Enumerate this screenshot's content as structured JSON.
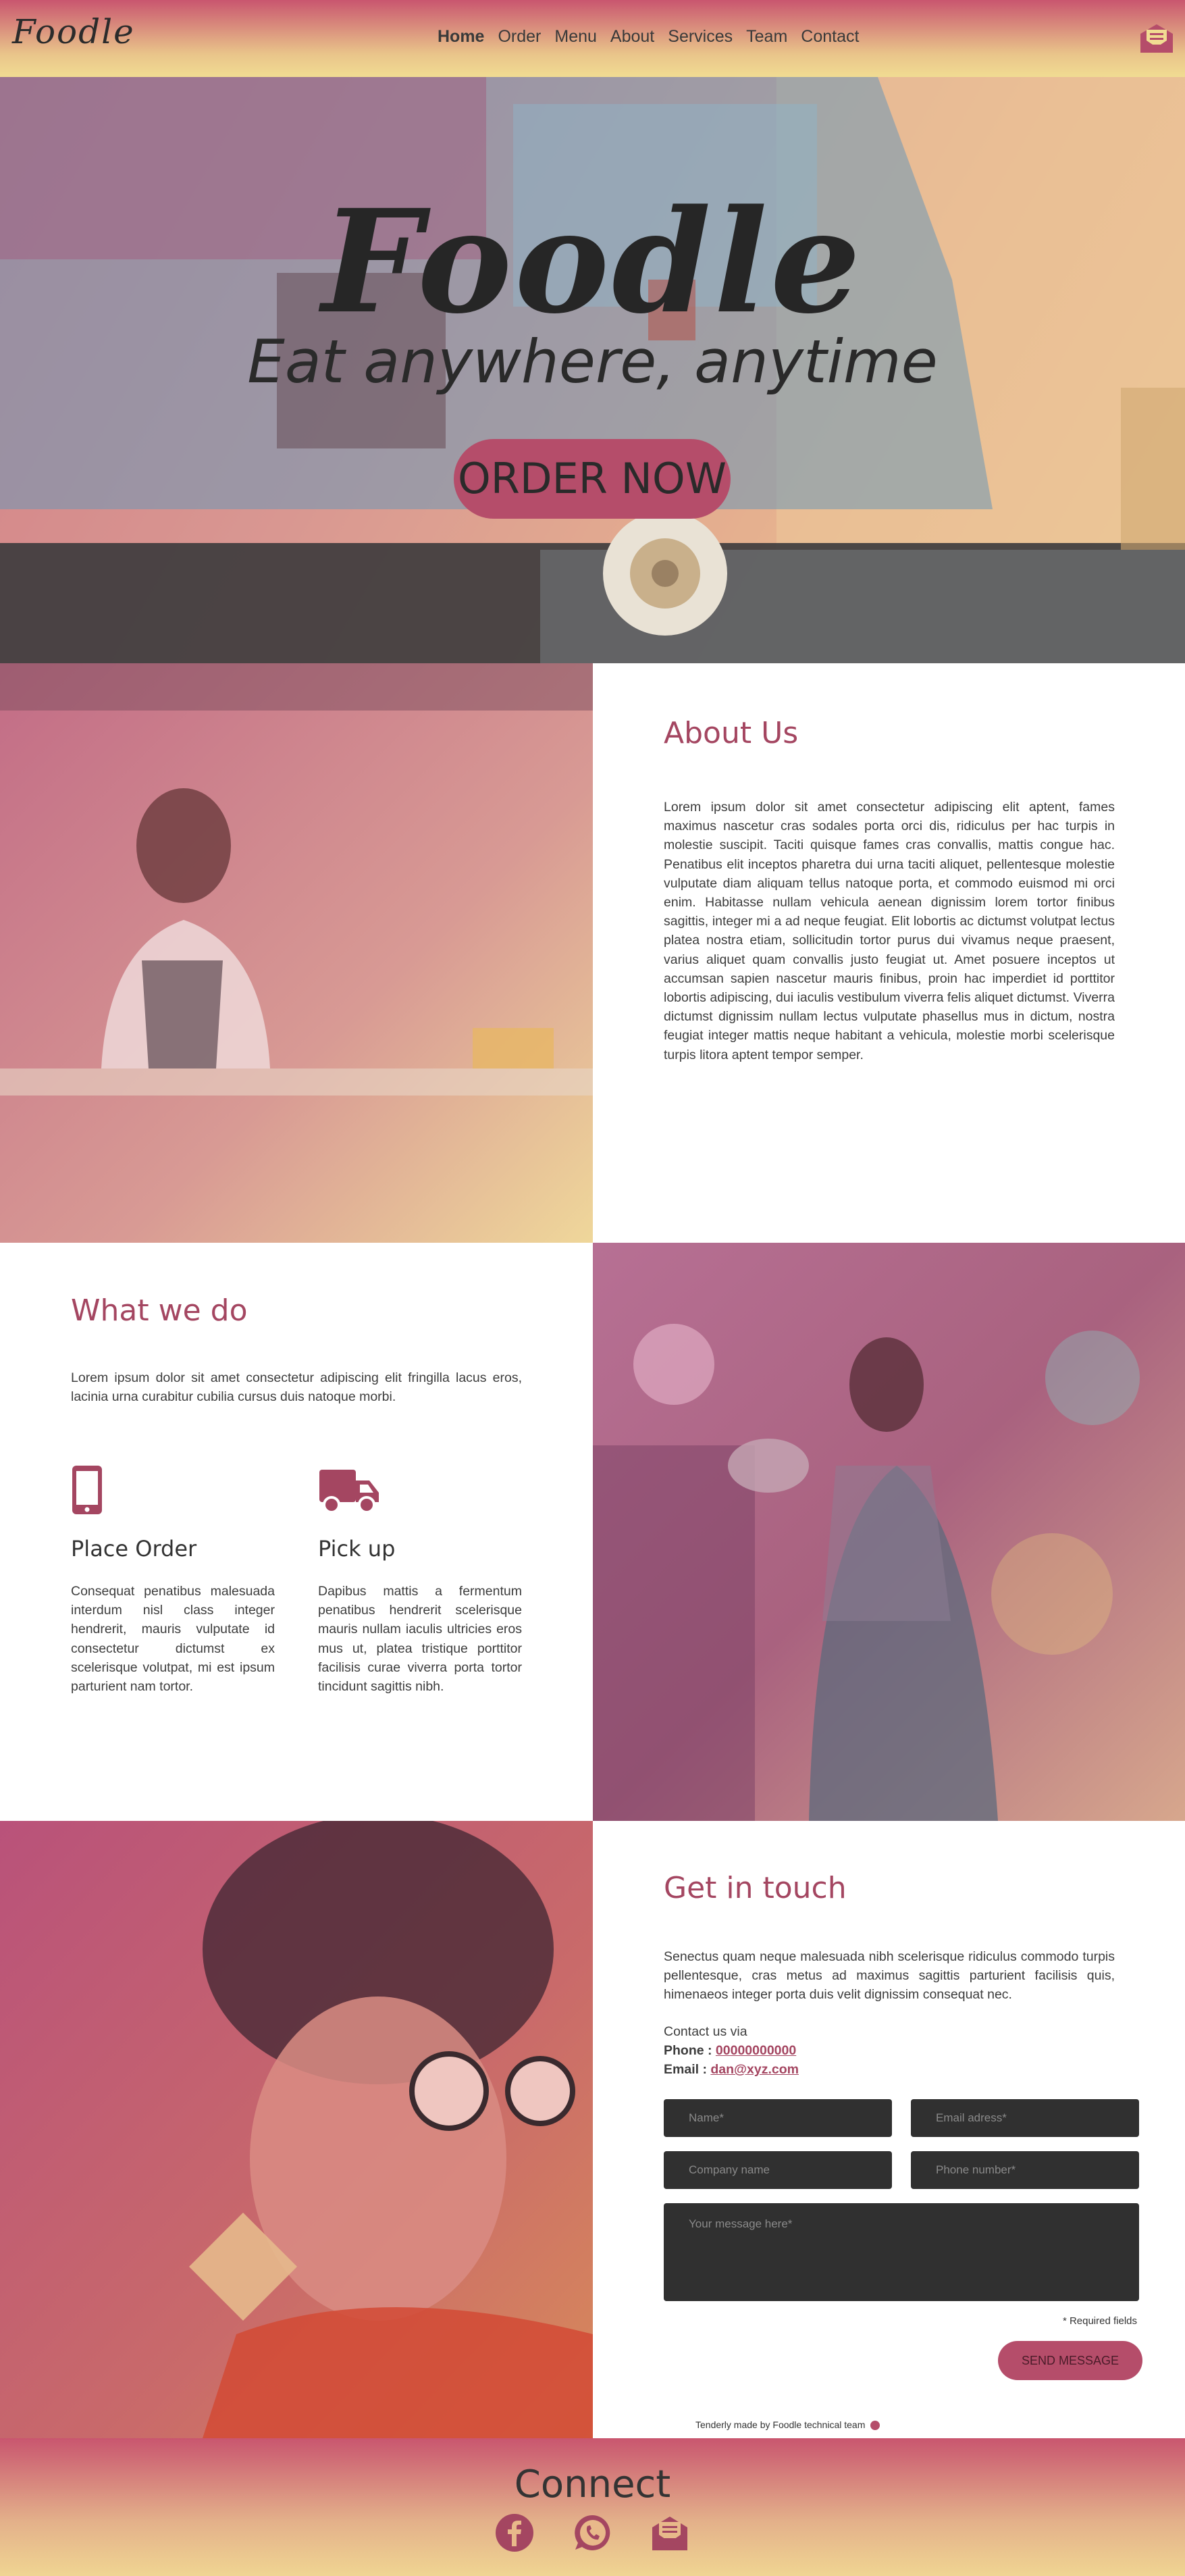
{
  "nav": {
    "logo": "Foodle",
    "items": [
      "Home",
      "Order",
      "Menu",
      "About",
      "Services",
      "Team",
      "Contact"
    ],
    "icon": "mail-icon"
  },
  "hero": {
    "title": "Foodle",
    "subtitle": "Eat anywhere, anytime",
    "cta": "ORDER NOW"
  },
  "about": {
    "title": "About Us",
    "body": "Lorem ipsum dolor sit amet consectetur adipiscing elit aptent, fames maximus nascetur cras sodales porta orci dis, ridiculus per hac turpis in molestie suscipit. Taciti quisque fames cras convallis, mattis congue hac. Penatibus elit inceptos pharetra dui urna taciti aliquet, pellentesque molestie vulputate diam aliquam tellus natoque porta, et commodo euismod mi orci enim. Habitasse nullam vehicula aenean dignissim lorem tortor finibus sagittis, integer mi a ad neque feugiat. Elit lobortis ac dictumst volutpat lectus platea nostra etiam, sollicitudin tortor purus dui vivamus neque praesent, varius aliquet quam convallis justo feugiat ut. Amet posuere inceptos ut accumsan sapien nascetur mauris finibus, proin hac imperdiet id porttitor lobortis adipiscing, dui iaculis vestibulum viverra felis aliquet dictumst. Viverra dictumst dignissim nullam lectus vulputate phasellus mus in dictum, nostra feugiat integer mattis neque habitant a vehicula, molestie morbi scelerisque turpis litora aptent tempor semper."
  },
  "what": {
    "title": "What we do",
    "intro": "Lorem ipsum dolor sit amet consectetur adipiscing elit fringilla lacus eros, lacinia urna curabitur cubilia cursus duis natoque morbi.",
    "features": [
      {
        "title": "Place Order",
        "icon": "phone-icon",
        "body": "Consequat penatibus malesuada interdum nisl class integer hendrerit, mauris vulputate id consectetur dictumst ex scelerisque volutpat, mi est ipsum parturient nam tortor."
      },
      {
        "title": "Pick up",
        "icon": "truck-icon",
        "body": "Dapibus mattis a fermentum penatibus hendrerit scelerisque mauris nullam iaculis ultricies eros mus ut, platea tristique porttitor facilisis curae viverra porta tortor tincidunt sagittis nibh."
      }
    ]
  },
  "contact": {
    "title": "Get in touch",
    "intro": "Senectus quam neque malesuada nibh scelerisque ridiculus commodo turpis pellentesque, cras metus ad maximus sagittis parturient facilisis quis, himenaeos integer porta duis velit dignissim consequat nec.",
    "via": "Contact us via",
    "phone_label": "Phone :",
    "phone": "00000000000",
    "email_label": "Email :",
    "email": "dan@xyz.com",
    "fields": {
      "name": "Name*",
      "email": "Email adress*",
      "company": "Company name",
      "phone": "Phone number*",
      "message": "Your message here*"
    },
    "required_note": "* Required fields",
    "send": "SEND MESSAGE",
    "credit": "Tenderly made by Foodle technical team"
  },
  "footer": {
    "title": "Connect",
    "icons": [
      "facebook-icon",
      "whatsapp-icon",
      "mail-icon"
    ]
  },
  "colors": {
    "accent": "#b54d6a",
    "title": "#a44661",
    "gradient_top": "#c9566f",
    "gradient_bottom": "#f1dc92",
    "field": "#303030"
  }
}
